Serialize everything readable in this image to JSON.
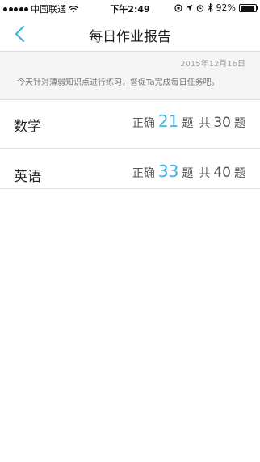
{
  "status_bar": {
    "carrier": "中国联通",
    "time": "下午2:49",
    "battery": "92%",
    "battery_level": 0.92
  },
  "nav": {
    "title": "每日作业报告",
    "back_icon": "chevron-left-icon",
    "accent_color": "#3fb1e3"
  },
  "info": {
    "date": "2015年12月16日",
    "description": "今天针对薄弱知识点进行练习，督促Ta完成每日任务吧。"
  },
  "subjects": [
    {
      "name": "数学",
      "correct_label": "正确",
      "correct": "21",
      "unit": "题",
      "total_label": "共",
      "total": "30",
      "unit2": "题"
    },
    {
      "name": "英语",
      "correct_label": "正确",
      "correct": "33",
      "unit": "题",
      "total_label": "共",
      "total": "40",
      "unit2": "题"
    }
  ]
}
